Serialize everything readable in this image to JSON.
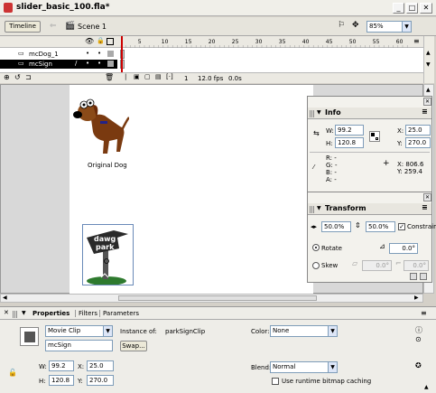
{
  "window": {
    "title": "slider_basic_100.fla*"
  },
  "timeline": {
    "tab": "Timeline",
    "scene": "Scene 1",
    "zoom": "85%",
    "frames": [
      "5",
      "10",
      "15",
      "20",
      "25",
      "30",
      "35",
      "40",
      "45",
      "50",
      "55",
      "60"
    ],
    "layers": [
      {
        "name": "mcDog_1"
      },
      {
        "name": "mcSign"
      }
    ],
    "frame": "1",
    "fps": "12.0 fps",
    "time": "0.0s"
  },
  "stage": {
    "dog_label": "Original Dog",
    "sign_text": "dawg park"
  },
  "info": {
    "title": "Info",
    "w_label": "W:",
    "w": "99.2",
    "h_label": "H:",
    "h": "120.8",
    "x_label": "X:",
    "x": "25.0",
    "y_label": "Y:",
    "y": "270.0",
    "r": "R: -",
    "g": "G: -",
    "b": "B: -",
    "a": "A: -",
    "cx": "X: 806.6",
    "cy": "Y: 259.4"
  },
  "transform": {
    "title": "Transform",
    "scale_w": "50.0%",
    "scale_h": "50.0%",
    "constrain": "Constrain",
    "rotate": "Rotate",
    "rotate_val": "0.0°",
    "skew": "Skew",
    "skew1": "0.0°",
    "skew2": "0.0°"
  },
  "properties": {
    "tabs": [
      "Properties",
      "Filters",
      "Parameters"
    ],
    "symbol_type": "Movie Clip",
    "instance_name": "mcSign",
    "instance_of_label": "Instance of:",
    "instance_of": "parkSignClip",
    "swap": "Swap...",
    "color_label": "Color:",
    "color": "None",
    "w_label": "W:",
    "w": "99.2",
    "h_label": "H:",
    "h": "120.8",
    "x_label": "X:",
    "x": "25.0",
    "y_label": "Y:",
    "y": "270.0",
    "blend_label": "Blend:",
    "blend": "Normal",
    "cache": "Use runtime bitmap caching"
  }
}
